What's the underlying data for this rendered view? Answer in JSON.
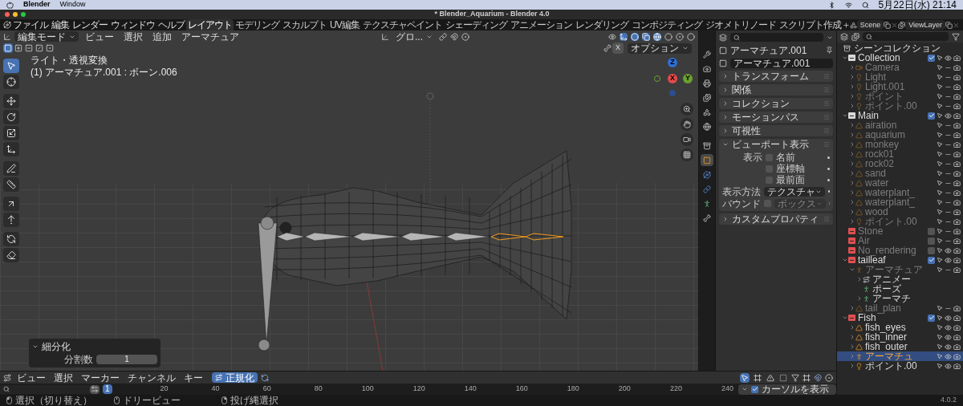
{
  "menubar": {
    "app": "Blender",
    "menus": [
      "Window"
    ],
    "clock": "5月22日(水)  21:14"
  },
  "window": {
    "title": "* Blender_Aquarium - Blender 4.0"
  },
  "topbar": {
    "menus": [
      "ファイル",
      "編集",
      "レンダー",
      "ウィンドウ",
      "ヘルプ"
    ],
    "workspaces": [
      {
        "label": "レイアウト",
        "selected": true
      },
      {
        "label": "モデリング",
        "selected": false
      },
      {
        "label": "スカルプト",
        "selected": false
      },
      {
        "label": "UV編集",
        "selected": false
      },
      {
        "label": "テクスチャペイント",
        "selected": false
      },
      {
        "label": "シェーディング",
        "selected": false
      },
      {
        "label": "アニメーション",
        "selected": false
      },
      {
        "label": "レンダリング",
        "selected": false
      },
      {
        "label": "コンポジティング",
        "selected": false
      },
      {
        "label": "ジオメトリノード",
        "selected": false
      },
      {
        "label": "スクリプト作成",
        "selected": false
      }
    ],
    "scene": "Scene",
    "view_layer": "ViewLayer"
  },
  "viewport": {
    "mode": "編集モード",
    "menus": [
      "ビュー",
      "選択",
      "追加",
      "アーマチュア"
    ],
    "orientation": "グロ...",
    "axis_toggle": "X",
    "options": "オプション",
    "view_name": "ライト・透視変換",
    "object_info": "(1) アーマチュア.001 : ボーン.006",
    "select_modes": [
      {
        "kind": "set",
        "selected": true
      },
      {
        "kind": "extend",
        "selected": false
      },
      {
        "kind": "subtract",
        "selected": false
      },
      {
        "kind": "invert",
        "selected": false
      },
      {
        "kind": "intersect",
        "selected": false
      }
    ],
    "toggles": {
      "gizmos": true,
      "overlays": true,
      "xray": true
    },
    "shading": [
      {
        "kind": "wireframe",
        "selected": true
      },
      {
        "kind": "solid",
        "selected": false
      },
      {
        "kind": "material",
        "selected": false
      },
      {
        "kind": "rendered",
        "selected": false
      }
    ],
    "tools": [
      {
        "kind": "select",
        "selected": true
      },
      {
        "kind": "cursor",
        "selected": false
      },
      {
        "kind": "move",
        "selected": false
      },
      {
        "kind": "rotate",
        "selected": false
      },
      {
        "kind": "scale",
        "selected": false
      },
      {
        "kind": "transform",
        "selected": false
      },
      {
        "kind": "annotate",
        "selected": false
      },
      {
        "kind": "measure",
        "selected": false
      },
      {
        "kind": "extrude",
        "selected": false
      },
      {
        "kind": "extrude_cursor",
        "selected": false
      },
      {
        "kind": "roll",
        "selected": false
      },
      {
        "kind": "envelope",
        "selected": false
      }
    ],
    "gizmo": [
      {
        "label": "Z",
        "color": "#2f6fd6"
      },
      {
        "label": "X",
        "color": "#e64a4a"
      },
      {
        "label": "Y",
        "color": "#6aa12f"
      }
    ],
    "redo_panel": {
      "title": "細分化",
      "expanded": true,
      "field_label": "分割数",
      "value": "1"
    }
  },
  "properties": {
    "object_name": "アーマチュア.001",
    "data_name": "アーマチュア.001",
    "tabs": [
      {
        "kind": "tool",
        "selected": false
      },
      {
        "kind": "render",
        "selected": false
      },
      {
        "kind": "output",
        "selected": false
      },
      {
        "kind": "view_layer",
        "selected": false
      },
      {
        "kind": "scene",
        "selected": false
      },
      {
        "kind": "world",
        "selected": false
      },
      {
        "kind": "collection",
        "selected": false
      },
      {
        "kind": "object",
        "selected": true
      },
      {
        "kind": "physics",
        "selected": false
      },
      {
        "kind": "constraints",
        "selected": false
      },
      {
        "kind": "data",
        "selected": false
      },
      {
        "kind": "bone",
        "selected": false
      }
    ],
    "panels": [
      {
        "label": "トランスフォーム",
        "expanded": false
      },
      {
        "label": "関係",
        "expanded": false
      },
      {
        "label": "コレクション",
        "expanded": false
      },
      {
        "label": "モーションパス",
        "expanded": false
      },
      {
        "label": "可視性",
        "expanded": false
      },
      {
        "label": "ビューポート表示",
        "expanded": true
      },
      {
        "label": "カスタムプロパティ",
        "expanded": false
      }
    ],
    "viewport_display": {
      "show_label": "表示",
      "checks": [
        {
          "label": "名前",
          "checked": false
        },
        {
          "label": "座標軸",
          "checked": false
        },
        {
          "label": "最前面",
          "checked": false
        }
      ],
      "display_as_label": "表示方法",
      "display_as": "テクスチャ",
      "bounds_label": "バウンド",
      "bounds_checked": false,
      "bounds_type": "ボックス"
    }
  },
  "outliner": {
    "root": "シーンコレクション",
    "items": [
      {
        "name": "Collection",
        "kind": "collection",
        "color": "#d9d9d9",
        "expanded": true,
        "checked": true,
        "visible": true,
        "selected": false,
        "children": [
          {
            "name": "Camera",
            "kind": "camera",
            "expanded": false,
            "visible": false,
            "selected": false
          },
          {
            "name": "Light",
            "kind": "light",
            "expanded": false,
            "visible": false,
            "selected": false
          },
          {
            "name": "Light.001",
            "kind": "light",
            "expanded": false,
            "visible": false,
            "selected": false
          },
          {
            "name": "ポイント",
            "kind": "light",
            "expanded": false,
            "visible": false,
            "selected": false
          },
          {
            "name": "ポイント.00",
            "kind": "light",
            "expanded": false,
            "visible": false,
            "selected": false
          }
        ]
      },
      {
        "name": "Main",
        "kind": "collection",
        "color": "#d9d9d9",
        "expanded": true,
        "checked": true,
        "visible": true,
        "selected": false,
        "children": [
          {
            "name": "airation",
            "kind": "mesh",
            "expanded": false,
            "visible": false,
            "selected": false
          },
          {
            "name": "aquarium",
            "kind": "mesh",
            "expanded": false,
            "visible": false,
            "selected": false
          },
          {
            "name": "monkey",
            "kind": "mesh",
            "expanded": false,
            "visible": false,
            "selected": false
          },
          {
            "name": "rock01",
            "kind": "mesh",
            "expanded": false,
            "visible": false,
            "selected": false
          },
          {
            "name": "rock02",
            "kind": "mesh",
            "expanded": false,
            "visible": false,
            "selected": false
          },
          {
            "name": "sand",
            "kind": "mesh",
            "expanded": false,
            "visible": false,
            "selected": false
          },
          {
            "name": "water",
            "kind": "mesh",
            "expanded": false,
            "visible": false,
            "selected": false
          },
          {
            "name": "waterplant_",
            "kind": "mesh",
            "expanded": false,
            "visible": false,
            "selected": false
          },
          {
            "name": "waterplant_",
            "kind": "mesh",
            "expanded": false,
            "visible": false,
            "selected": false
          },
          {
            "name": "wood",
            "kind": "mesh",
            "expanded": false,
            "visible": false,
            "selected": false
          },
          {
            "name": "ポイント.00",
            "kind": "light",
            "expanded": false,
            "visible": false,
            "selected": false
          }
        ]
      },
      {
        "name": "Stone",
        "kind": "collection",
        "color": "#e05050",
        "checked": false,
        "visible": false,
        "selected": false
      },
      {
        "name": "Air",
        "kind": "collection",
        "color": "#e05050",
        "checked": false,
        "visible": false,
        "selected": false
      },
      {
        "name": "No_rendering",
        "kind": "collection",
        "color": "#e05050",
        "checked": false,
        "visible": true,
        "selected": false
      },
      {
        "name": "tailleaf",
        "kind": "collection",
        "color": "#e05050",
        "expanded": true,
        "checked": true,
        "visible": true,
        "selected": false,
        "children": [
          {
            "name": "アーマチュア",
            "kind": "armature",
            "expanded": true,
            "visible": false,
            "selected": false,
            "children": [
              {
                "name": "アニメー",
                "kind": "action",
                "expanded": false,
                "selected": false
              },
              {
                "name": "ポーズ",
                "kind": "pose",
                "selected": false
              },
              {
                "name": "アーマチ",
                "kind": "armature_data",
                "expanded": false,
                "selected": false
              }
            ]
          },
          {
            "name": "tail_plan",
            "kind": "mesh",
            "expanded": false,
            "visible": false,
            "selected": false
          }
        ]
      },
      {
        "name": "Fish",
        "kind": "collection",
        "color": "#e05050",
        "expanded": true,
        "checked": true,
        "visible": true,
        "selected": false,
        "children": [
          {
            "name": "fish_eyes",
            "kind": "mesh",
            "expanded": false,
            "visible": true,
            "selected": false
          },
          {
            "name": "fish_inner",
            "kind": "mesh",
            "expanded": false,
            "visible": true,
            "selected": false
          },
          {
            "name": "fish_outer",
            "kind": "mesh",
            "expanded": false,
            "visible": true,
            "selected": false
          },
          {
            "name": "アーマチュ",
            "kind": "armature",
            "expanded": false,
            "visible": true,
            "selected": true
          },
          {
            "name": "ポイント.00",
            "kind": "light",
            "expanded": false,
            "visible": true,
            "selected": false
          }
        ]
      }
    ]
  },
  "timeline": {
    "menus": [
      "ビュー",
      "選択",
      "マーカー",
      "チャンネル",
      "キー"
    ],
    "normalize": {
      "label": "正規化",
      "on": true
    },
    "filters": [
      {
        "kind": "only_selected",
        "on": true
      },
      {
        "kind": "frame",
        "on": false
      },
      {
        "kind": "errors",
        "on": false
      },
      {
        "kind": "hidden",
        "on": false
      }
    ],
    "current_frame": "1",
    "ticks": [
      "20",
      "40",
      "60",
      "80",
      "100",
      "120",
      "140",
      "160",
      "180",
      "200",
      "220",
      "240"
    ],
    "show_cursor": {
      "label": "カーソルを表示",
      "checked": true
    }
  },
  "status_bar": {
    "hints": [
      {
        "kind": "left_click",
        "label": "選択（切り替え）"
      },
      {
        "kind": "middle_click",
        "label": "ドリービュー"
      },
      {
        "kind": "right_click",
        "label": "投げ縄選択"
      }
    ],
    "version": "4.0.2"
  }
}
